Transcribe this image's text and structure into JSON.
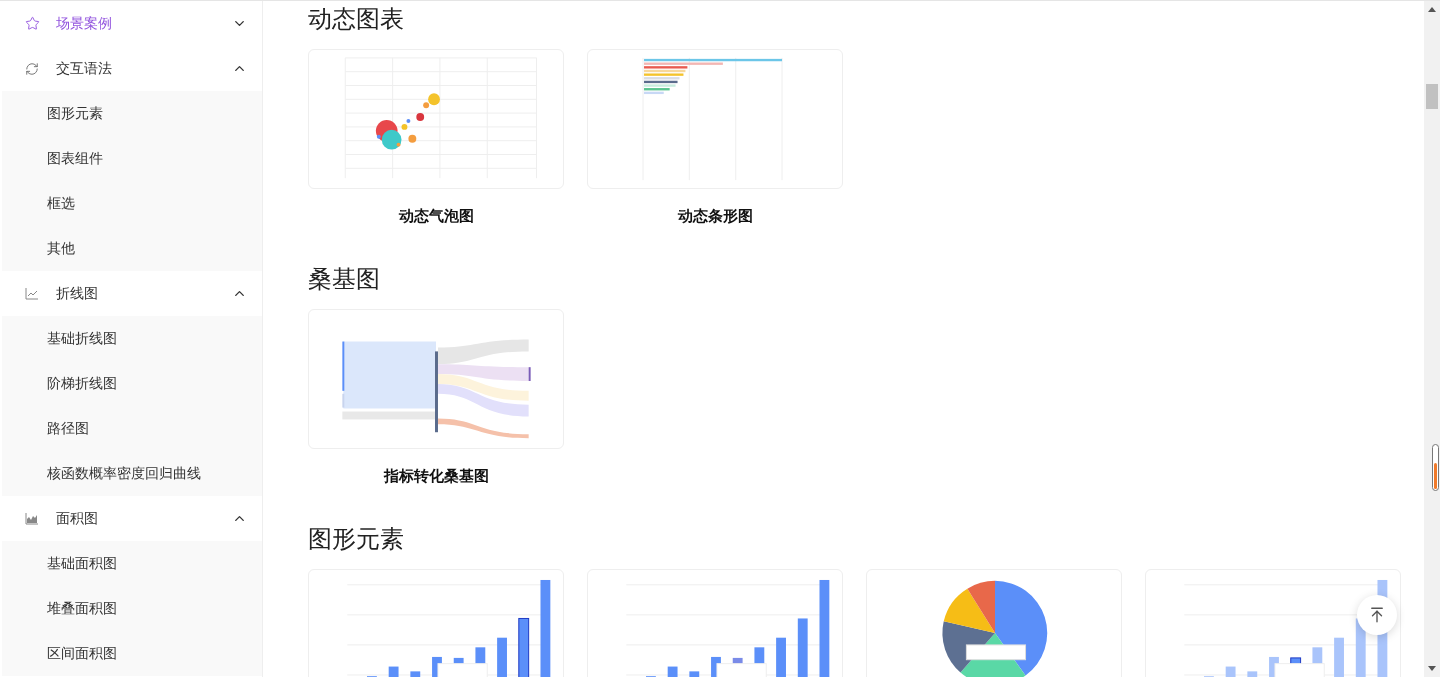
{
  "sidebar": {
    "groups": [
      {
        "label": "场景案例",
        "kind": "star",
        "selected": true,
        "expanded": false
      },
      {
        "label": "交互语法",
        "kind": "refresh",
        "selected": false,
        "expanded": true,
        "children": [
          {
            "label": "图形元素"
          },
          {
            "label": "图表组件"
          },
          {
            "label": "框选"
          },
          {
            "label": "其他"
          }
        ]
      },
      {
        "label": "折线图",
        "kind": "line",
        "selected": false,
        "expanded": true,
        "children": [
          {
            "label": "基础折线图"
          },
          {
            "label": "阶梯折线图"
          },
          {
            "label": "路径图"
          },
          {
            "label": "核函数概率密度回归曲线"
          }
        ]
      },
      {
        "label": "面积图",
        "kind": "area",
        "selected": false,
        "expanded": true,
        "children": [
          {
            "label": "基础面积图"
          },
          {
            "label": "堆叠面积图"
          },
          {
            "label": "区间面积图"
          }
        ]
      }
    ]
  },
  "sections": [
    {
      "title": "动态图表",
      "cards": [
        {
          "kind": "bubble",
          "title": "动态气泡图"
        },
        {
          "kind": "bar-race",
          "title": "动态条形图"
        }
      ]
    },
    {
      "title": "桑基图",
      "cards": [
        {
          "kind": "sankey",
          "title": "指标转化桑基图"
        }
      ]
    },
    {
      "title": "图形元素",
      "cards": [
        {
          "kind": "bar"
        },
        {
          "kind": "bar-hover"
        },
        {
          "kind": "pie"
        },
        {
          "kind": "bar-faded"
        }
      ]
    }
  ]
}
